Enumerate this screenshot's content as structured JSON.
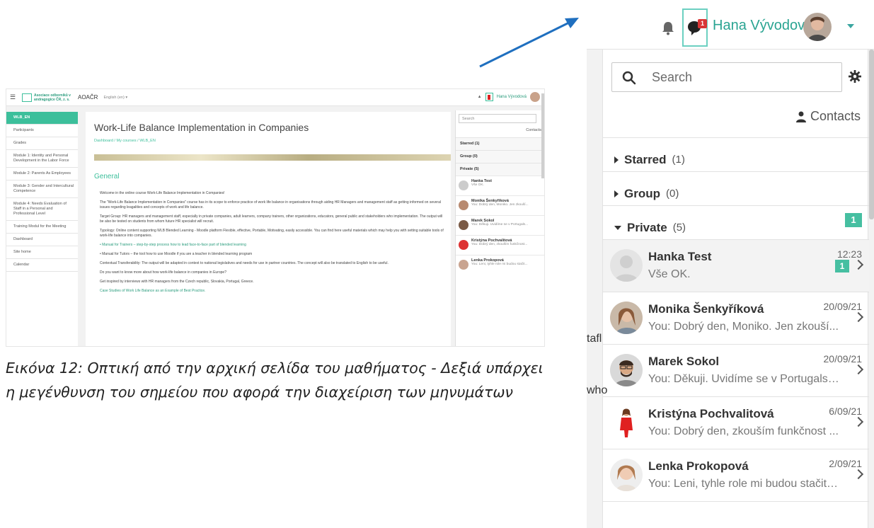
{
  "screenshot": {
    "header": {
      "site_name": "AOAČR",
      "logo_text": "Asociace odborníků v andragogice ČR, z. s.",
      "language": "English (en) ▾",
      "user_name": "Hana Vývodová"
    },
    "nav": [
      {
        "label": "WLB_EN"
      },
      {
        "label": "Participants"
      },
      {
        "label": "Grades"
      },
      {
        "label": "Module 1: Identity and Personal Development in the Labor Force"
      },
      {
        "label": "Module 2: Parents As Employees"
      },
      {
        "label": "Module 3: Gender and Intercultural Competence"
      },
      {
        "label": "Module 4: Needs Evaluation of Staff in a Personal and Professional Level"
      },
      {
        "label": "Training Modul for the Meeting"
      },
      {
        "label": "Dashboard"
      },
      {
        "label": "Site home"
      },
      {
        "label": "Calendar"
      }
    ],
    "course": {
      "title": "Work-Life Balance Implementation in Companies",
      "breadcrumb": "Dashboard / My courses / WLB_EN",
      "section": "General",
      "paragraphs": [
        "Welcome in the online course Work-Life Balance Implementation in Companies!",
        "The \"Work-Life Balance Implementation in Companies\" course has in its scope to enforce practice of work life balance in organisations through aiding HR Managers and management staff as getting informed on several issues regarding leagalities and concepts of work and life balance.",
        "Target Group: HR managers and management staff, especially in private companies, adult learners, company trainers, other organizations, educators, general public and stakeholders who implementation. The output will be also be tested on students from whom future HR specialist will recruit.",
        "Typology: Online content supporting WLB Blended Learning - Moodle platform Flexible, effective, Portable, Motivating, easily accessible. You can find here useful materials which may help you with setting suitable tools of work-life balance into companies.",
        "• Manual for Trainers – step-by-step process how to lead face-to-face part of blended learning",
        "• Manual for Tutors – the tool how to use Moodle if you are a teacher in blended learning program",
        "Contextual Transferability: The output will be adapted in context to national legislatives and needs for use in partner countries. The concept will also be translated to English to be useful.",
        "Do you want to know more about how work-life balance in companies in Europe?",
        "Get inspired by interviews with HR managers from the Czech republic, Slovakia, Portugal, Greece.",
        "Case Studies of Work Life Balance as an Example of Best Practice."
      ]
    },
    "drawer": {
      "search_placeholder": "Search",
      "contacts": "Contacts",
      "starred": "Starred (1)",
      "group": "Group (0)",
      "private": "Private (5)",
      "private_badge": "1",
      "rows": [
        {
          "name": "Hanka Test",
          "preview": "Vše OK.",
          "time": "12:23"
        },
        {
          "name": "Monika Šenkyříková",
          "preview": "You: Dobrý den, Moniko. Jen zkouší...",
          "time": "20/09/21"
        },
        {
          "name": "Marek Sokol",
          "preview": "You: Děkuji. Uvidíme se v Portugals...",
          "time": "20/09/21"
        },
        {
          "name": "Kristýna Pochvalitová",
          "preview": "You: Dobrý den, zkouším funkčnost...",
          "time": "6/09/21"
        },
        {
          "name": "Lenka Prokopová",
          "preview": "You: Leni, tyhle role mi budou stačit...",
          "time": "2/09/21"
        }
      ]
    }
  },
  "caption": "Εικόνα 12: Οπτική από την αρχική σελίδα του μαθήματος - Δεξιά υπάρχει η μεγένθυνση του σημείου που αφορά την διαχείριση των μηνυμάτων",
  "zoom": {
    "header": {
      "user_name": "Hana Vývodová",
      "message_badge": "1"
    },
    "search": {
      "placeholder": "Search"
    },
    "contacts_label": "Contacts",
    "sections": {
      "starred": {
        "label": "Starred",
        "count": "(1)"
      },
      "group": {
        "label": "Group",
        "count": "(0)"
      },
      "private": {
        "label": "Private",
        "count": "(5)",
        "badge": "1"
      }
    },
    "conversations": [
      {
        "name": "Hanka Test",
        "preview": "Vše OK.",
        "time": "12:23",
        "unread": "1"
      },
      {
        "name": "Monika Šenkyříková",
        "preview": "You: Dobrý den, Moniko. Jen zkouší...",
        "time": "20/09/21"
      },
      {
        "name": "Marek Sokol",
        "preview": "You: Děkuji. Uvidíme se v Portugalsk...",
        "time": "20/09/21"
      },
      {
        "name": "Kristýna Pochvalitová",
        "preview": "You: Dobrý den, zkouším funkčnost ...",
        "time": "6/09/21"
      },
      {
        "name": "Lenka Prokopová",
        "preview": "You: Leni, tyhle role mi budou stačit. ...",
        "time": "2/09/21"
      }
    ],
    "background_peek": {
      "line1": "tafl",
      "line2": "who"
    }
  },
  "colors": {
    "accent": "#3cbf9b",
    "user_name": "#2aa492",
    "badge_red": "#d93535",
    "arrow": "#1f6fbf"
  }
}
